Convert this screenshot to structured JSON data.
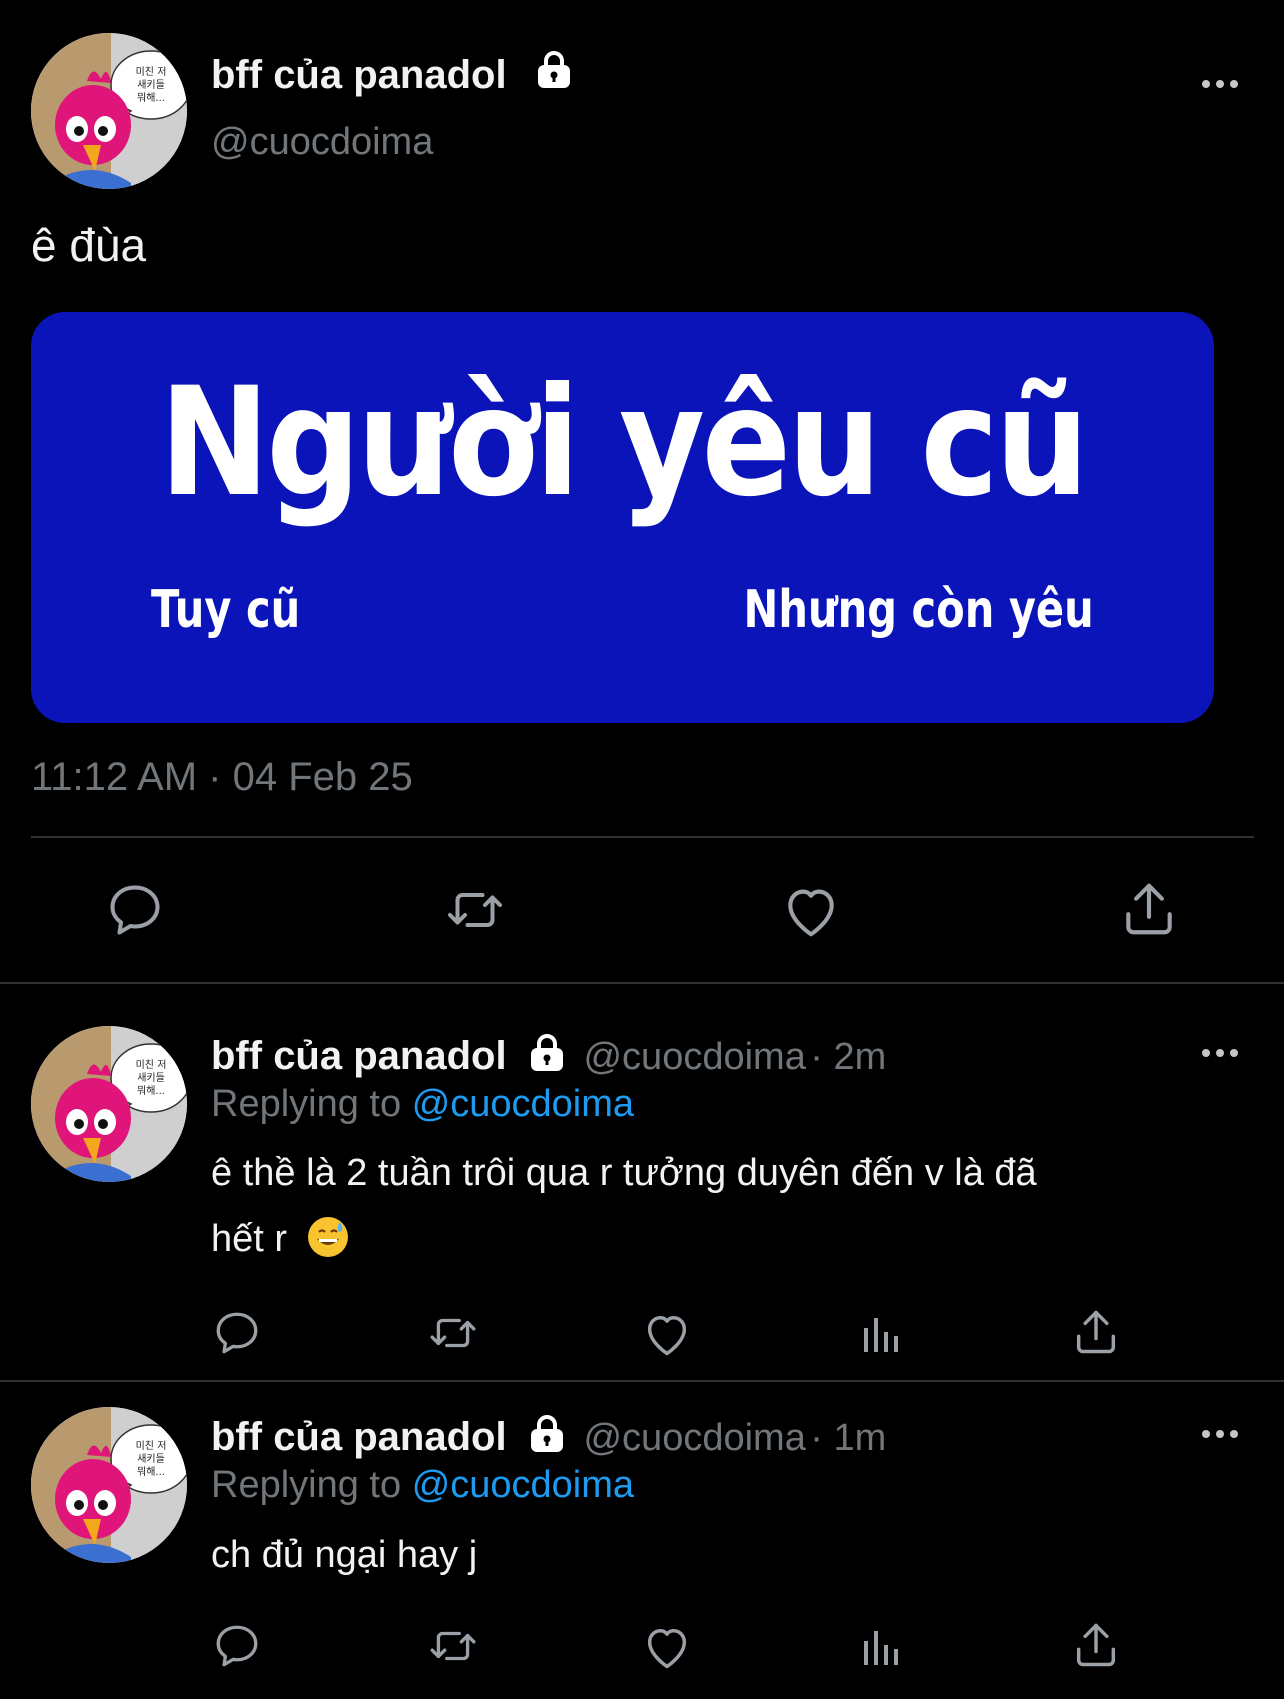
{
  "main_tweet": {
    "author_name": "bff của panadol",
    "author_handle": "@cuocdoima",
    "text": "ê đùa",
    "media": {
      "title": "Người yêu cũ",
      "subtitle_left": "Tuy cũ",
      "subtitle_right": "Nhưng còn yêu",
      "background": "#0a14b9"
    },
    "timestamp": "11:12 AM · 04 Feb 25",
    "actions": [
      "reply-icon",
      "retweet-icon",
      "like-icon",
      "share-icon"
    ]
  },
  "replies": [
    {
      "author_name": "bff của panadol",
      "author_handle": "@cuocdoima",
      "time_ago": "· 2m",
      "replying_prefix": "Replying to",
      "replying_to": "@cuocdoima",
      "text_line1": "ê thề là 2 tuần trôi qua r tưởng duyên đến v là đã",
      "text_line2": "hết r",
      "emoji": "sweat-smile-emoji"
    },
    {
      "author_name": "bff của panadol",
      "author_handle": "@cuocdoima",
      "time_ago": "· 1m",
      "replying_prefix": "Replying to",
      "replying_to": "@cuocdoima",
      "text_line1": "ch đủ ngại hay j"
    }
  ],
  "avatar_bubble_text": "미친 저 새키들 뭐해...",
  "colors": {
    "background": "#000000",
    "text": "#f2f2f2",
    "muted": "#71767b",
    "link": "#1d9bf0",
    "divider": "#2f3336"
  }
}
